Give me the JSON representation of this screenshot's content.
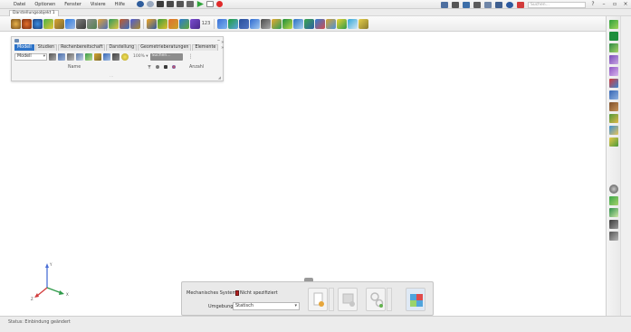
{
  "menu": {
    "items": [
      "Datei",
      "Optionen",
      "Fenster",
      "Visiere",
      "Hilfe"
    ],
    "search_placeholder": "Suchen..."
  },
  "tabs": {
    "document": "Darstellungsobjekt 1"
  },
  "toolbar": {
    "numeric_label": "123"
  },
  "model_panel": {
    "tabs": [
      "Modell",
      "Studien",
      "Rechenbereitschaft",
      "Darstellung",
      "Geometrieberatungen",
      "Elemente"
    ],
    "more": "» »",
    "view_select": "Modell",
    "zoom_label": "100% ▾",
    "search_placeholder": "Suchen...",
    "column_name": "Name",
    "column_count": "Anzahl"
  },
  "triad": {
    "x_label": "X",
    "y_label": "Y",
    "z_label": "Z"
  },
  "analysis_panel": {
    "coord_system_label": "Mechanisches System:",
    "coord_system_value": "Nicht spezifiziert",
    "environment_label": "Umgebungstyp:",
    "environment_value": "Statisch"
  },
  "status": {
    "text": "Status: Einbindung geändert"
  },
  "colors": {
    "accent": "#2d73c8",
    "warning_marker": "#b32020"
  }
}
